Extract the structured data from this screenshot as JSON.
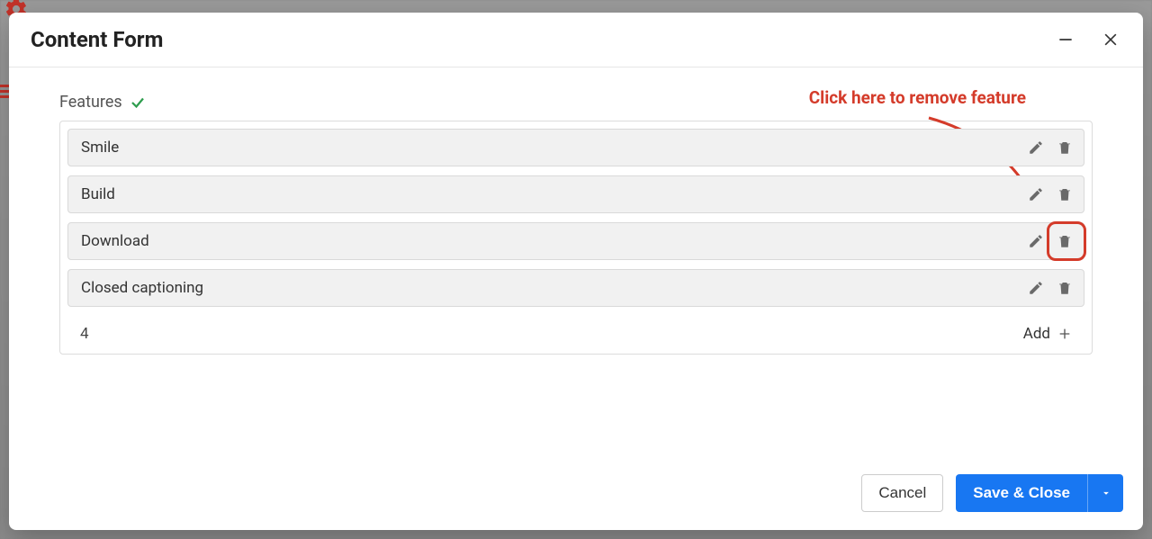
{
  "modal": {
    "title": "Content Form",
    "section_label": "Features",
    "items": [
      {
        "label": "Smile"
      },
      {
        "label": "Build"
      },
      {
        "label": "Download"
      },
      {
        "label": "Closed captioning"
      }
    ],
    "count": "4",
    "add_label": "Add"
  },
  "annotation": {
    "text": "Click here to remove feature"
  },
  "footer": {
    "cancel": "Cancel",
    "save": "Save & Close"
  },
  "colors": {
    "accent": "#1877f2",
    "annotation": "#d43b2a",
    "success": "#2e9d4e"
  }
}
